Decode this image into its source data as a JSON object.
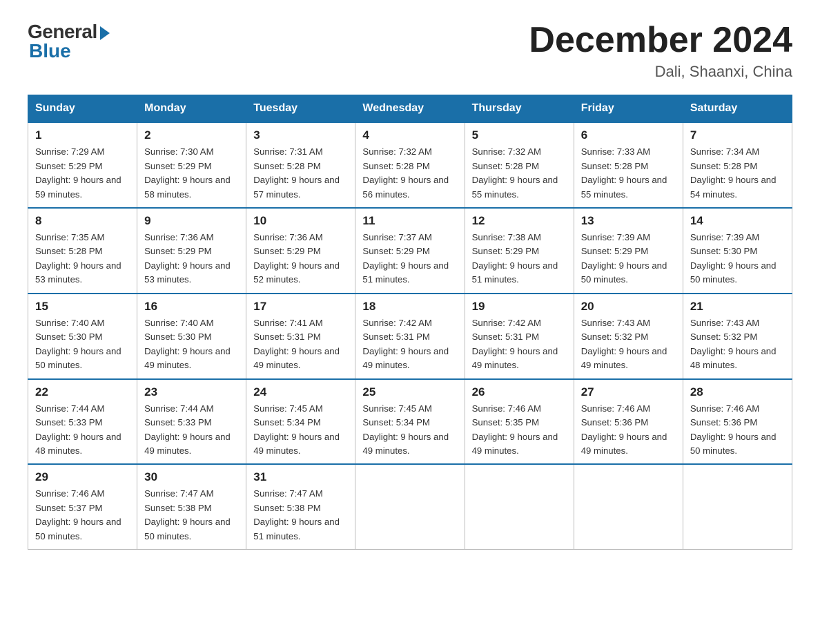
{
  "header": {
    "logo_general": "General",
    "logo_blue": "Blue",
    "title": "December 2024",
    "location": "Dali, Shaanxi, China"
  },
  "days_of_week": [
    "Sunday",
    "Monday",
    "Tuesday",
    "Wednesday",
    "Thursday",
    "Friday",
    "Saturday"
  ],
  "weeks": [
    [
      {
        "day": "1",
        "sunrise": "7:29 AM",
        "sunset": "5:29 PM",
        "daylight": "9 hours and 59 minutes."
      },
      {
        "day": "2",
        "sunrise": "7:30 AM",
        "sunset": "5:29 PM",
        "daylight": "9 hours and 58 minutes."
      },
      {
        "day": "3",
        "sunrise": "7:31 AM",
        "sunset": "5:28 PM",
        "daylight": "9 hours and 57 minutes."
      },
      {
        "day": "4",
        "sunrise": "7:32 AM",
        "sunset": "5:28 PM",
        "daylight": "9 hours and 56 minutes."
      },
      {
        "day": "5",
        "sunrise": "7:32 AM",
        "sunset": "5:28 PM",
        "daylight": "9 hours and 55 minutes."
      },
      {
        "day": "6",
        "sunrise": "7:33 AM",
        "sunset": "5:28 PM",
        "daylight": "9 hours and 55 minutes."
      },
      {
        "day": "7",
        "sunrise": "7:34 AM",
        "sunset": "5:28 PM",
        "daylight": "9 hours and 54 minutes."
      }
    ],
    [
      {
        "day": "8",
        "sunrise": "7:35 AM",
        "sunset": "5:28 PM",
        "daylight": "9 hours and 53 minutes."
      },
      {
        "day": "9",
        "sunrise": "7:36 AM",
        "sunset": "5:29 PM",
        "daylight": "9 hours and 53 minutes."
      },
      {
        "day": "10",
        "sunrise": "7:36 AM",
        "sunset": "5:29 PM",
        "daylight": "9 hours and 52 minutes."
      },
      {
        "day": "11",
        "sunrise": "7:37 AM",
        "sunset": "5:29 PM",
        "daylight": "9 hours and 51 minutes."
      },
      {
        "day": "12",
        "sunrise": "7:38 AM",
        "sunset": "5:29 PM",
        "daylight": "9 hours and 51 minutes."
      },
      {
        "day": "13",
        "sunrise": "7:39 AM",
        "sunset": "5:29 PM",
        "daylight": "9 hours and 50 minutes."
      },
      {
        "day": "14",
        "sunrise": "7:39 AM",
        "sunset": "5:30 PM",
        "daylight": "9 hours and 50 minutes."
      }
    ],
    [
      {
        "day": "15",
        "sunrise": "7:40 AM",
        "sunset": "5:30 PM",
        "daylight": "9 hours and 50 minutes."
      },
      {
        "day": "16",
        "sunrise": "7:40 AM",
        "sunset": "5:30 PM",
        "daylight": "9 hours and 49 minutes."
      },
      {
        "day": "17",
        "sunrise": "7:41 AM",
        "sunset": "5:31 PM",
        "daylight": "9 hours and 49 minutes."
      },
      {
        "day": "18",
        "sunrise": "7:42 AM",
        "sunset": "5:31 PM",
        "daylight": "9 hours and 49 minutes."
      },
      {
        "day": "19",
        "sunrise": "7:42 AM",
        "sunset": "5:31 PM",
        "daylight": "9 hours and 49 minutes."
      },
      {
        "day": "20",
        "sunrise": "7:43 AM",
        "sunset": "5:32 PM",
        "daylight": "9 hours and 49 minutes."
      },
      {
        "day": "21",
        "sunrise": "7:43 AM",
        "sunset": "5:32 PM",
        "daylight": "9 hours and 48 minutes."
      }
    ],
    [
      {
        "day": "22",
        "sunrise": "7:44 AM",
        "sunset": "5:33 PM",
        "daylight": "9 hours and 48 minutes."
      },
      {
        "day": "23",
        "sunrise": "7:44 AM",
        "sunset": "5:33 PM",
        "daylight": "9 hours and 49 minutes."
      },
      {
        "day": "24",
        "sunrise": "7:45 AM",
        "sunset": "5:34 PM",
        "daylight": "9 hours and 49 minutes."
      },
      {
        "day": "25",
        "sunrise": "7:45 AM",
        "sunset": "5:34 PM",
        "daylight": "9 hours and 49 minutes."
      },
      {
        "day": "26",
        "sunrise": "7:46 AM",
        "sunset": "5:35 PM",
        "daylight": "9 hours and 49 minutes."
      },
      {
        "day": "27",
        "sunrise": "7:46 AM",
        "sunset": "5:36 PM",
        "daylight": "9 hours and 49 minutes."
      },
      {
        "day": "28",
        "sunrise": "7:46 AM",
        "sunset": "5:36 PM",
        "daylight": "9 hours and 50 minutes."
      }
    ],
    [
      {
        "day": "29",
        "sunrise": "7:46 AM",
        "sunset": "5:37 PM",
        "daylight": "9 hours and 50 minutes."
      },
      {
        "day": "30",
        "sunrise": "7:47 AM",
        "sunset": "5:38 PM",
        "daylight": "9 hours and 50 minutes."
      },
      {
        "day": "31",
        "sunrise": "7:47 AM",
        "sunset": "5:38 PM",
        "daylight": "9 hours and 51 minutes."
      },
      null,
      null,
      null,
      null
    ]
  ]
}
